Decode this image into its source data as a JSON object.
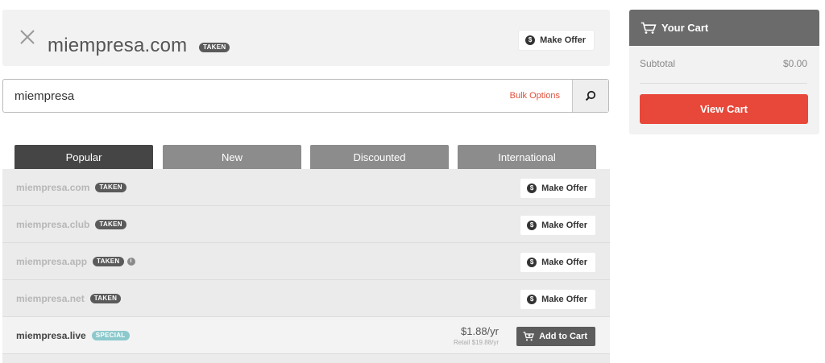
{
  "top_result": {
    "domain": "miempresa.com",
    "badge": "TAKEN",
    "offer_label": "Make Offer"
  },
  "search": {
    "value": "miempresa",
    "bulk_label": "Bulk Options"
  },
  "tabs": [
    {
      "label": "Popular",
      "active": true
    },
    {
      "label": "New",
      "active": false
    },
    {
      "label": "Discounted",
      "active": false
    },
    {
      "label": "International",
      "active": false
    }
  ],
  "results": [
    {
      "domain": "miempresa.com",
      "badge": "TAKEN",
      "action": "Make Offer"
    },
    {
      "domain": "miempresa.club",
      "badge": "TAKEN",
      "action": "Make Offer"
    },
    {
      "domain": "miempresa.app",
      "badge": "TAKEN",
      "action": "Make Offer"
    },
    {
      "domain": "miempresa.net",
      "badge": "TAKEN",
      "action": "Make Offer"
    },
    {
      "domain": "miempresa.live",
      "badge": "SPECIAL",
      "price": "$1.88/yr",
      "retail": "Retail $19.88/yr",
      "action": "Add to Cart"
    }
  ],
  "cart": {
    "title": "Your Cart",
    "subtotal_label": "Subtotal",
    "subtotal_value": "$0.00",
    "view_label": "View Cart"
  },
  "icons": {
    "close": "close-icon",
    "dollar": "$",
    "search": "search-icon",
    "cart": "cart-icon",
    "info": "i"
  },
  "colors": {
    "accent_red": "#e8483a",
    "bulk_red": "#e3503c",
    "special_badge": "#8cc9cc",
    "active_tab": "#454545",
    "inactive_tab": "#8c8c8c"
  }
}
